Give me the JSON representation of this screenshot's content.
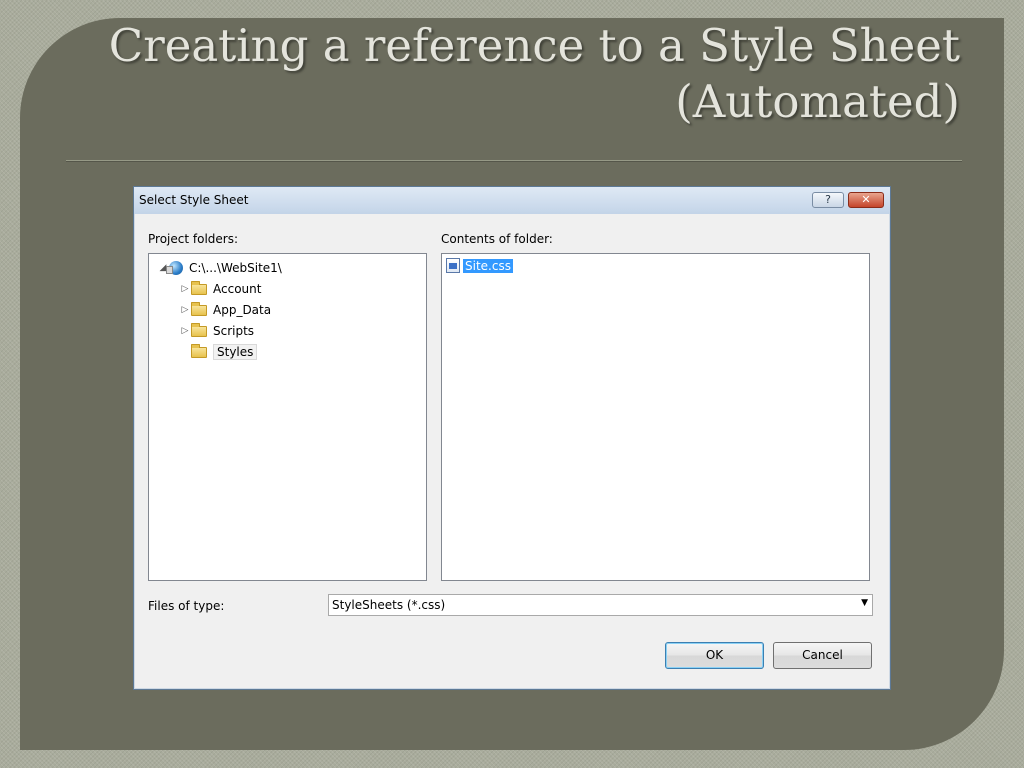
{
  "slide": {
    "title": "Creating a reference to a Style Sheet (Automated)"
  },
  "dialog": {
    "title": "Select Style Sheet",
    "help_label": "?",
    "close_label": "✕",
    "project_folders_label": "Project folders:",
    "contents_label": "Contents of folder:",
    "tree": {
      "root": "C:\\...\\WebSite1\\",
      "items": [
        {
          "label": "Account",
          "expander": "▷"
        },
        {
          "label": "App_Data",
          "expander": "▷"
        },
        {
          "label": "Scripts",
          "expander": "▷"
        },
        {
          "label": "Styles",
          "expander": ""
        }
      ],
      "root_expander": "◢"
    },
    "files": [
      {
        "name": "Site.css",
        "icon": "css-file-icon"
      }
    ],
    "files_of_type_label": "Files of type:",
    "files_of_type_value": "StyleSheets (*.css)",
    "ok_label": "OK",
    "cancel_label": "Cancel"
  }
}
